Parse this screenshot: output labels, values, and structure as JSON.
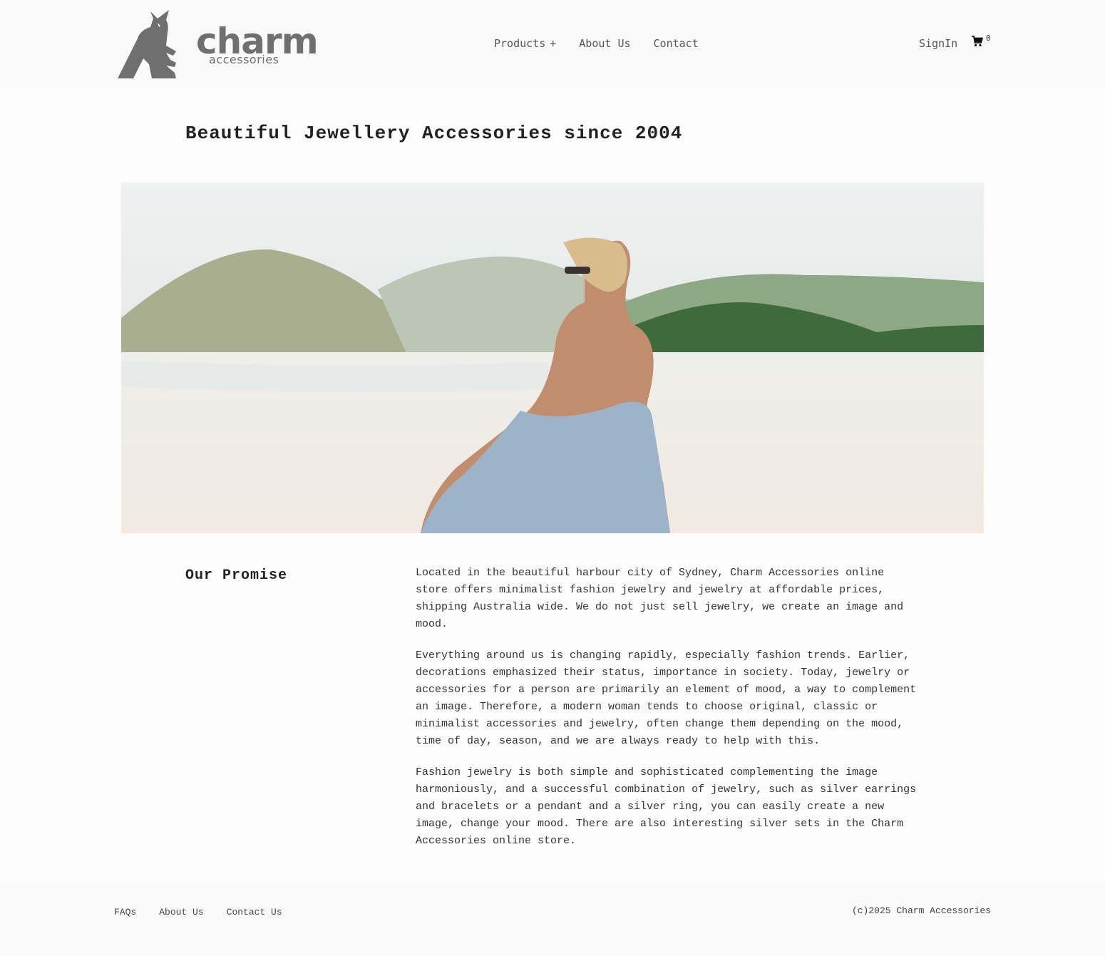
{
  "header": {
    "logo": {
      "brand": "charm",
      "sub": "accessories"
    },
    "nav": [
      {
        "label": "Products"
      },
      {
        "label": "About Us"
      },
      {
        "label": "Contact"
      }
    ],
    "products_toggle": "+",
    "signin_label": "SignIn",
    "cart_count": "0",
    "icons": {
      "cart": "cart-icon",
      "logo": "kangaroo-logo-icon"
    }
  },
  "main": {
    "title": "Beautiful Jewellery Accessories since 2004",
    "promise": {
      "title": "Our Promise",
      "paragraphs": [
        "Located in the beautiful harbour city of Sydney, Charm Accessories online store offers minimalist fashion jewelry and jewelry at affordable prices, shipping Australia wide. We do not just sell jewelry, we create an image and mood.",
        "Everything around us is changing rapidly, especially fashion trends. Earlier, decorations emphasized their status, importance in society. Today, jewelry or accessories for a person are primarily an element of mood, a way to complement an image. Therefore, a modern woman tends to choose original, classic or minimalist accessories and jewelry, often change them depending on the mood, time of day, season, and we are always ready to help with this.",
        "Fashion jewelry is both simple and sophisticated complementing the image harmoniously, and a successful combination of jewelry, such as silver earrings and bracelets or a pendant and a silver ring, you can easily create a new image, change your mood. There are also interesting silver sets in the Charm Accessories online store."
      ]
    }
  },
  "footer": {
    "links": [
      {
        "label": "FAQs"
      },
      {
        "label": "About Us"
      },
      {
        "label": "Contact Us"
      }
    ],
    "copyright": "(c)2025 Charm Accessories"
  },
  "colors": {
    "logo_gray": "#6f6f6f",
    "background": "#fcfcfc",
    "header_bg": "#f9f9f9",
    "text": "#333333"
  }
}
